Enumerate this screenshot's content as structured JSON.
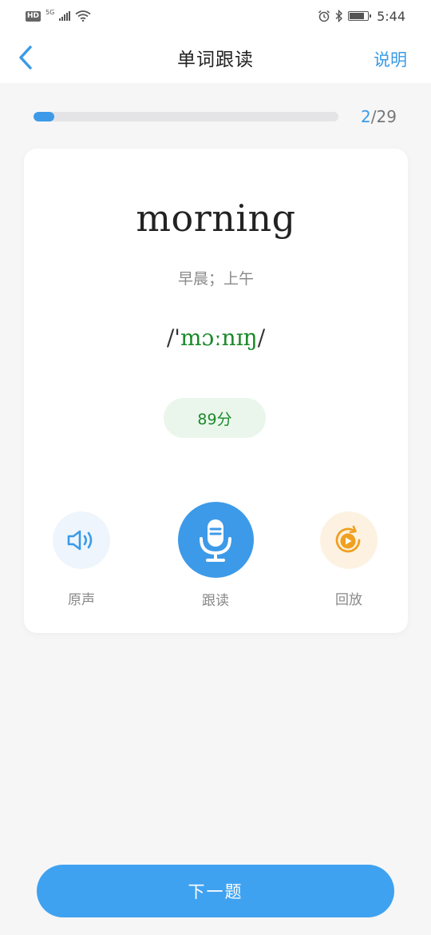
{
  "status_bar": {
    "hd_label": "HD",
    "network_label": "5G",
    "time": "5:44",
    "battery_level": 0.8,
    "icons": [
      "signal-icon",
      "wifi-icon",
      "alarm-icon",
      "bluetooth-icon",
      "battery-icon"
    ]
  },
  "nav": {
    "title": "单词跟读",
    "help_label": "说明",
    "back_icon": "chevron-left-icon"
  },
  "progress": {
    "current": "2",
    "separator": "/",
    "total": "29",
    "fraction": 0.069
  },
  "card": {
    "word": "morning",
    "meaning": "早晨；上午",
    "phonetic_open": "/'",
    "phonetic_body": "mɔːnɪŋ",
    "phonetic_close": "/",
    "score": "89分"
  },
  "actions": {
    "original_label": "原声",
    "record_label": "跟读",
    "playback_label": "回放"
  },
  "footer": {
    "next_label": "下一题"
  },
  "colors": {
    "accent_blue": "#3fa2f0",
    "phonetic_green": "#1a8a2a",
    "playback_orange": "#f0a020"
  }
}
